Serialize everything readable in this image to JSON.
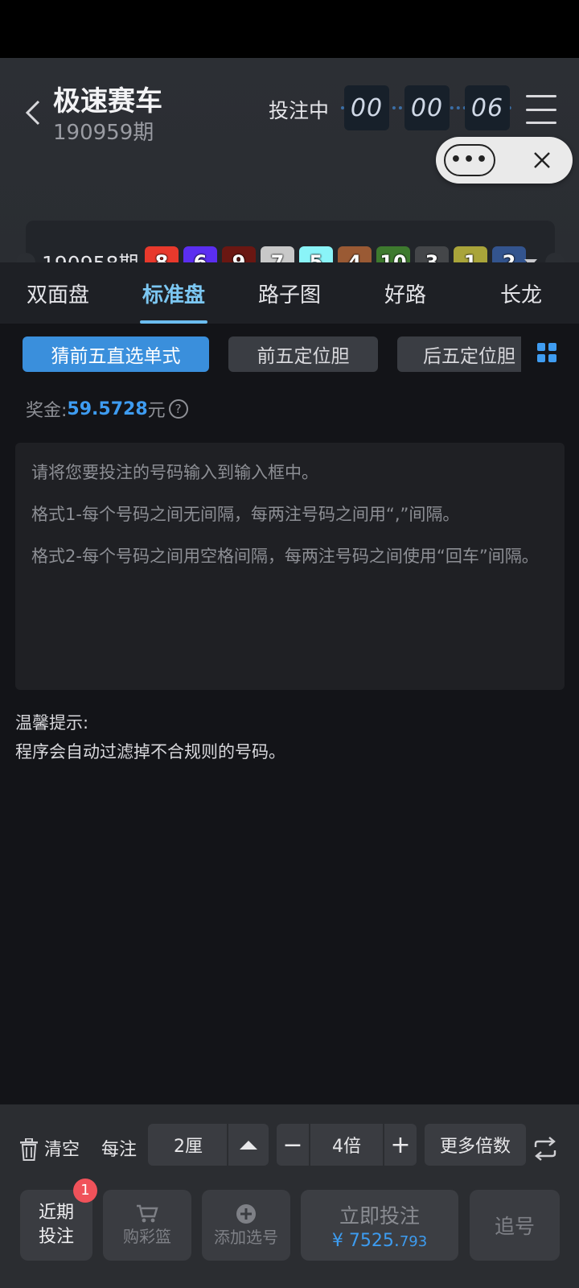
{
  "header": {
    "title": "极速赛车",
    "current_period": "190959期",
    "bet_status": "投注中",
    "countdown": [
      "00",
      "00",
      "06"
    ]
  },
  "capsule": {
    "more_label": "•••"
  },
  "last_result": {
    "period": "190958期",
    "balls": [
      {
        "num": "8",
        "color": "#e8392c"
      },
      {
        "num": "6",
        "color": "#5b2ef0"
      },
      {
        "num": "9",
        "color": "#6a1712"
      },
      {
        "num": "7",
        "color": "#c8c8c8"
      },
      {
        "num": "5",
        "color": "#8af4f8"
      },
      {
        "num": "4",
        "color": "#9a5a34"
      },
      {
        "num": "10",
        "color": "#3e7a2e"
      },
      {
        "num": "3",
        "color": "#444649"
      },
      {
        "num": "1",
        "color": "#a9a43a"
      },
      {
        "num": "2",
        "color": "#33548e"
      }
    ]
  },
  "tabs": [
    {
      "label": "双面盘",
      "active": false
    },
    {
      "label": "标准盘",
      "active": true
    },
    {
      "label": "路子图",
      "active": false
    },
    {
      "label": "好路",
      "active": false
    },
    {
      "label": "长龙",
      "active": false
    }
  ],
  "subtabs": [
    {
      "label": "猜前五直选单式",
      "active": true
    },
    {
      "label": "前五定位胆",
      "active": false
    },
    {
      "label": "后五定位胆",
      "active": false
    }
  ],
  "prize": {
    "label": "奖金:",
    "amount": "59.5728",
    "unit": "元",
    "help": "?"
  },
  "instructions": [
    "请将您要投注的号码输入到输入框中。",
    "格式1-每个号码之间无间隔，每两注号码之间用“,”间隔。",
    "格式2-每个号码之间用空格间隔，每两注号码之间使用“回车”间隔。"
  ],
  "tips": {
    "title": "温馨提示:",
    "text": "程序会自动过滤掉不合规则的号码。"
  },
  "controls": {
    "clear": "清空",
    "per_bet": "每注",
    "unit_value": "2厘",
    "minus": "−",
    "multiplier": "4倍",
    "plus": "+",
    "more_multiplier": "更多倍数"
  },
  "actions": {
    "recent_line1": "近期",
    "recent_line2": "投注",
    "recent_badge": "1",
    "cart": "购彩篮",
    "add_selection": "添加选号",
    "bet_now": "立即投注",
    "bet_currency": "¥",
    "bet_amount_main": "7525.",
    "bet_amount_decimal": "793",
    "chase": "追号"
  },
  "colors": {
    "accent": "#3e9cf1",
    "badge": "#f0525a"
  }
}
